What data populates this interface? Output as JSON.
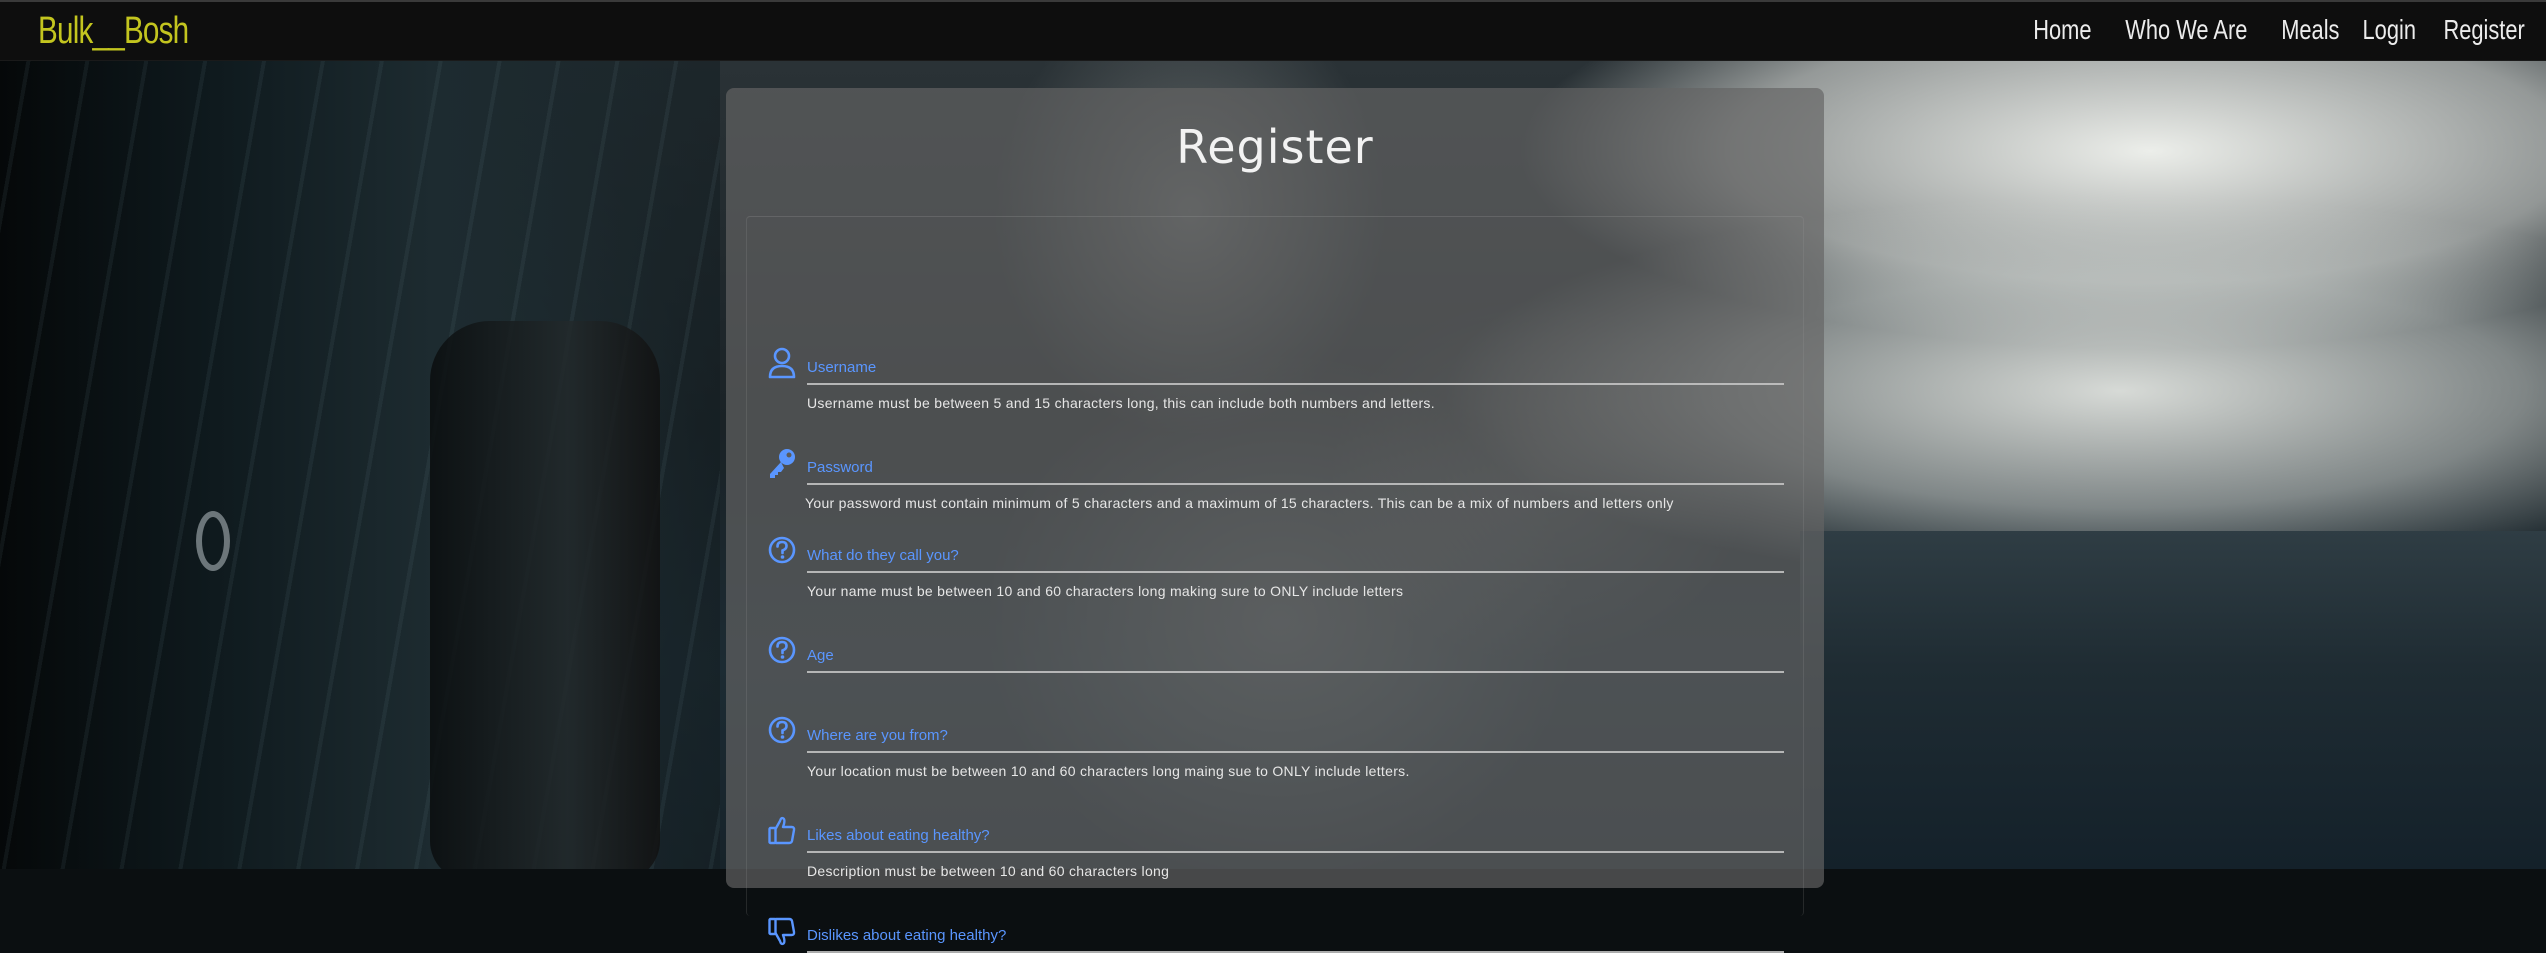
{
  "brand": "Bulk__Bosh",
  "nav": {
    "items": [
      {
        "label": "Home"
      },
      {
        "label": "Who We Are"
      },
      {
        "label": "Meals"
      },
      {
        "label": "Login"
      },
      {
        "label": "Register"
      }
    ]
  },
  "form": {
    "title": "Register",
    "fields": [
      {
        "label": "Username",
        "icon": "user-icon",
        "help": "Username must be between 5 and 15 characters long, this can include both numbers and letters."
      },
      {
        "label": "Password",
        "icon": "key-icon",
        "help": "Your password must contain minimum of 5 characters and a maximum of 15 characters. This can be a mix of numbers and letters only"
      },
      {
        "label": "What do they call you?",
        "icon": "question-circle-icon",
        "help": "Your name must be between 10 and 60 characters long making sure to ONLY include letters"
      },
      {
        "label": "Age",
        "icon": "question-circle-icon",
        "help": ""
      },
      {
        "label": "Where are you from?",
        "icon": "question-circle-icon",
        "help": "Your location must be between 10 and 60 characters long maing sue to ONLY include letters."
      },
      {
        "label": "Likes about eating healthy?",
        "icon": "thumbs-up-icon",
        "help": "Description must be between 10 and 60 characters long"
      },
      {
        "label": "Dislikes about eating healthy?",
        "icon": "thumbs-down-icon",
        "help": ""
      }
    ]
  },
  "colors": {
    "brand": "#c3c51f",
    "accent": "#5a96ff",
    "navbar": "#0e0e0e"
  }
}
